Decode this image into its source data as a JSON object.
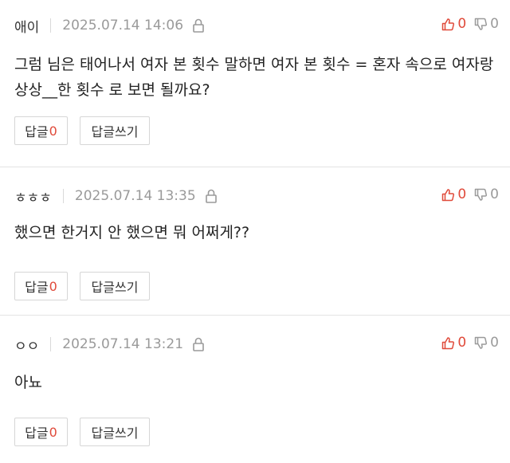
{
  "colors": {
    "accent": "#e04a3a",
    "muted": "#9a9a9a",
    "border": "#d6d6d6"
  },
  "icons": {
    "lock": "lock-icon",
    "thumb_up": "thumbs-up-icon",
    "thumb_down": "thumbs-down-icon"
  },
  "comments": [
    {
      "author": "애이",
      "date": "2025.07.14 14:06",
      "upvotes": "0",
      "downvotes": "0",
      "text": "그럼 님은 태어나서 여자 본 횟수 말하면 여자 본 횟수 = 혼자 속으로 여자랑 상상__한 횟수 로 보면 될까요?",
      "reply_label": "답글",
      "reply_count": "0",
      "write_label": "답글쓰기"
    },
    {
      "author": "ㅎㅎㅎ",
      "date": "2025.07.14 13:35",
      "upvotes": "0",
      "downvotes": "0",
      "text": "했으면 한거지 안 했으면 뭐 어쩌게??",
      "reply_label": "답글",
      "reply_count": "0",
      "write_label": "답글쓰기"
    },
    {
      "author": "ㅇㅇ",
      "date": "2025.07.14 13:21",
      "upvotes": "0",
      "downvotes": "0",
      "text": "아뇨",
      "reply_label": "답글",
      "reply_count": "0",
      "write_label": "답글쓰기"
    }
  ]
}
